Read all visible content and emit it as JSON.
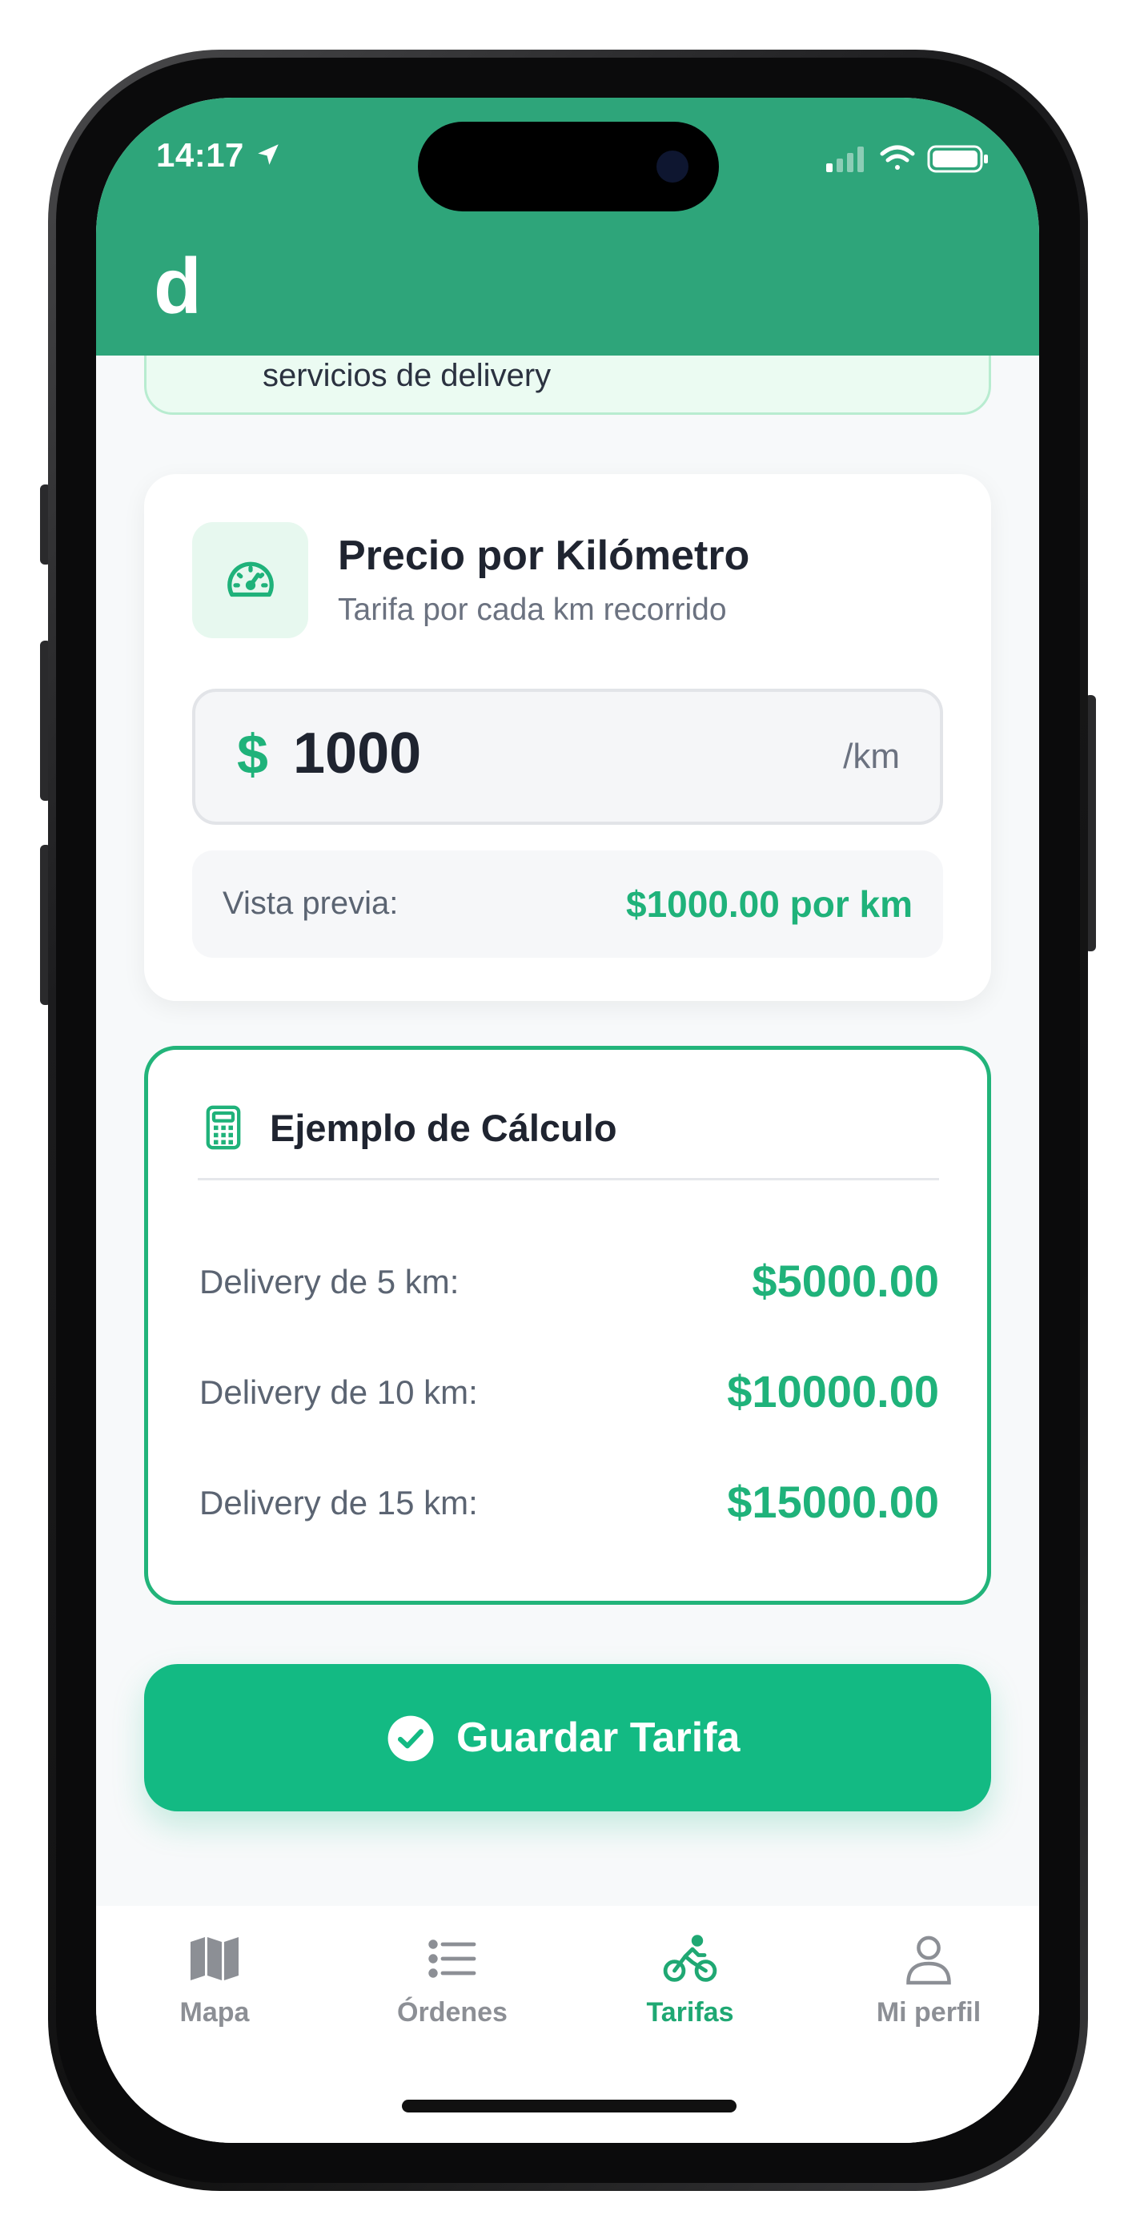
{
  "status_bar": {
    "time": "14:17"
  },
  "header": {
    "logo": "d"
  },
  "banner": {
    "text": "servicios de delivery"
  },
  "price_card": {
    "title": "Precio por Kilómetro",
    "subtitle": "Tarifa por cada km recorrido",
    "currency_symbol": "$",
    "value": "1000",
    "unit": "/km",
    "preview_label": "Vista previa:",
    "preview_value": "$1000.00 por km"
  },
  "example_card": {
    "title": "Ejemplo de Cálculo",
    "rows": [
      {
        "label": "Delivery de 5 km:",
        "value": "$5000.00"
      },
      {
        "label": "Delivery de 10 km:",
        "value": "$10000.00"
      },
      {
        "label": "Delivery de 15 km:",
        "value": "$15000.00"
      }
    ]
  },
  "save_button": {
    "label": "Guardar Tarifa"
  },
  "tabbar": {
    "tabs": [
      {
        "label": "Mapa",
        "icon": "map-icon",
        "active": false
      },
      {
        "label": "Órdenes",
        "icon": "list-icon",
        "active": false
      },
      {
        "label": "Tarifas",
        "icon": "bicycle-icon",
        "active": true
      },
      {
        "label": "Mi perfil",
        "icon": "person-icon",
        "active": false
      }
    ]
  },
  "colors": {
    "header_green": "#2ea57a",
    "accent_green": "#13ba83",
    "text_dark": "#1f2430",
    "text_muted": "#6b7280",
    "tab_inactive": "#8c8f95"
  }
}
